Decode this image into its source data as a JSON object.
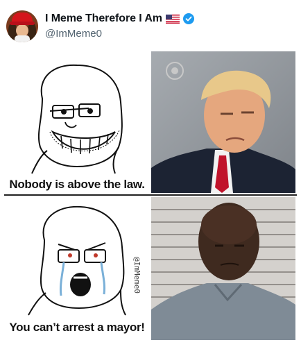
{
  "post": {
    "display_name": "I Meme Therefore I Am",
    "handle": "@ImMeme0",
    "flag_icon": "us-flag-icon",
    "verified_icon": "verified-badge-icon",
    "verified_color": "#1d9bf0"
  },
  "meme": {
    "top_caption": "Nobody is above the law.",
    "bottom_caption": "You can’t arrest a mayor!",
    "watermark": "@ImMeme0"
  }
}
